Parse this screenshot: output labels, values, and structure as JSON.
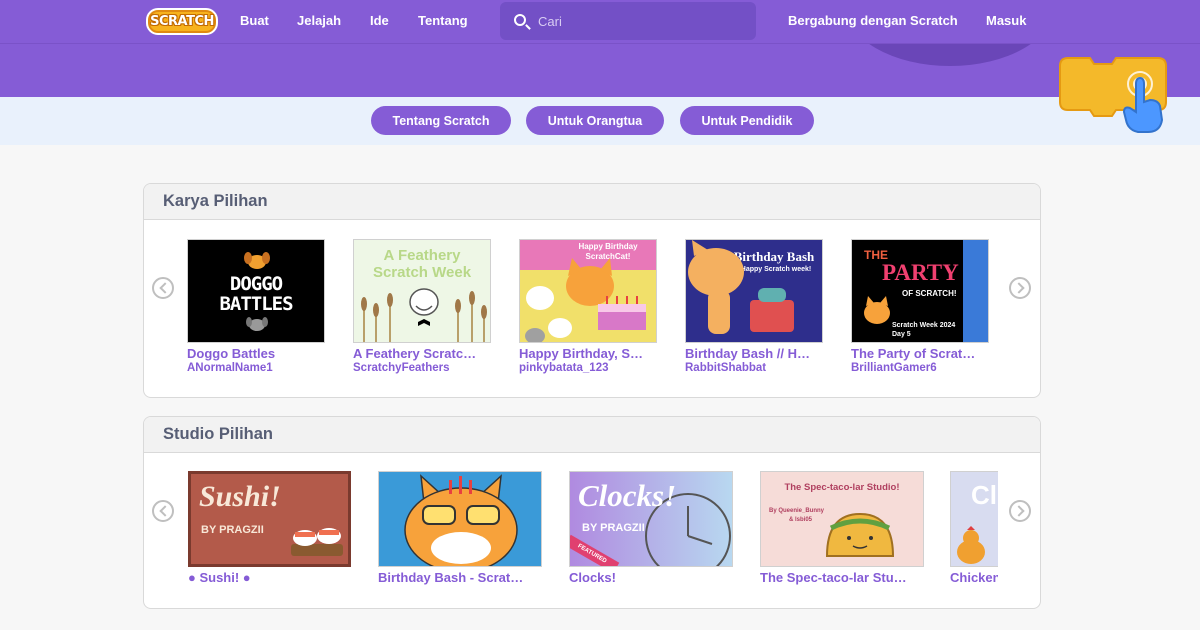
{
  "nav": {
    "logo_text": "SCRATCH",
    "links": [
      "Buat",
      "Jelajah",
      "Ide",
      "Tentang"
    ],
    "search_placeholder": "Cari",
    "join_label": "Bergabung dengan Scratch",
    "signin_label": "Masuk"
  },
  "tips": [
    "Tentang Scratch",
    "Untuk Orangtua",
    "Untuk Pendidik"
  ],
  "featured_projects": {
    "title": "Karya Pilihan",
    "items": [
      {
        "title": "Doggo Battles",
        "author": "ANormalName1",
        "thumb_text": [
          "DOGGO",
          "BATTLES"
        ]
      },
      {
        "title": "A Feathery Scratc…",
        "author": "ScratchyFeathers",
        "thumb_text": [
          "A Feathery",
          "Scratch Week"
        ]
      },
      {
        "title": "Happy Birthday, S…",
        "author": "pinkybatata_123",
        "thumb_text": [
          "Happy Birthday",
          "ScratchCat!"
        ]
      },
      {
        "title": "Birthday Bash // H…",
        "author": "RabbitShabbat",
        "thumb_text": [
          "Birthday Bash",
          "Happy Scratch week!"
        ]
      },
      {
        "title": "The Party of Scrat…",
        "author": "BrilliantGamer6",
        "thumb_text": [
          "THE",
          "PARTY",
          "OF SCRATCH!",
          "Scratch Week 2024",
          "Day 5"
        ]
      }
    ]
  },
  "featured_studios": {
    "title": "Studio Pilihan",
    "items": [
      {
        "title": "● Sushi! ●",
        "thumb_text": [
          "Sushi!",
          "BY PRAGZII"
        ]
      },
      {
        "title": "Birthday Bash - Scrat…",
        "thumb_text": []
      },
      {
        "title": "Clocks!",
        "thumb_text": [
          "Clocks!",
          "BY PRAGZII",
          "FEATURED"
        ]
      },
      {
        "title": "The Spec-taco-lar Stu…",
        "thumb_text": [
          "The Spec-taco-lar Studio!",
          "By Queenie_Bunny",
          "& lsbi05"
        ]
      },
      {
        "title": "Chicken",
        "thumb_text": [
          "Cl"
        ]
      }
    ]
  },
  "colors": {
    "brand_purple": "#855cd6",
    "tip_bar": "#e9f1fc",
    "heading_gray": "#575e75"
  }
}
